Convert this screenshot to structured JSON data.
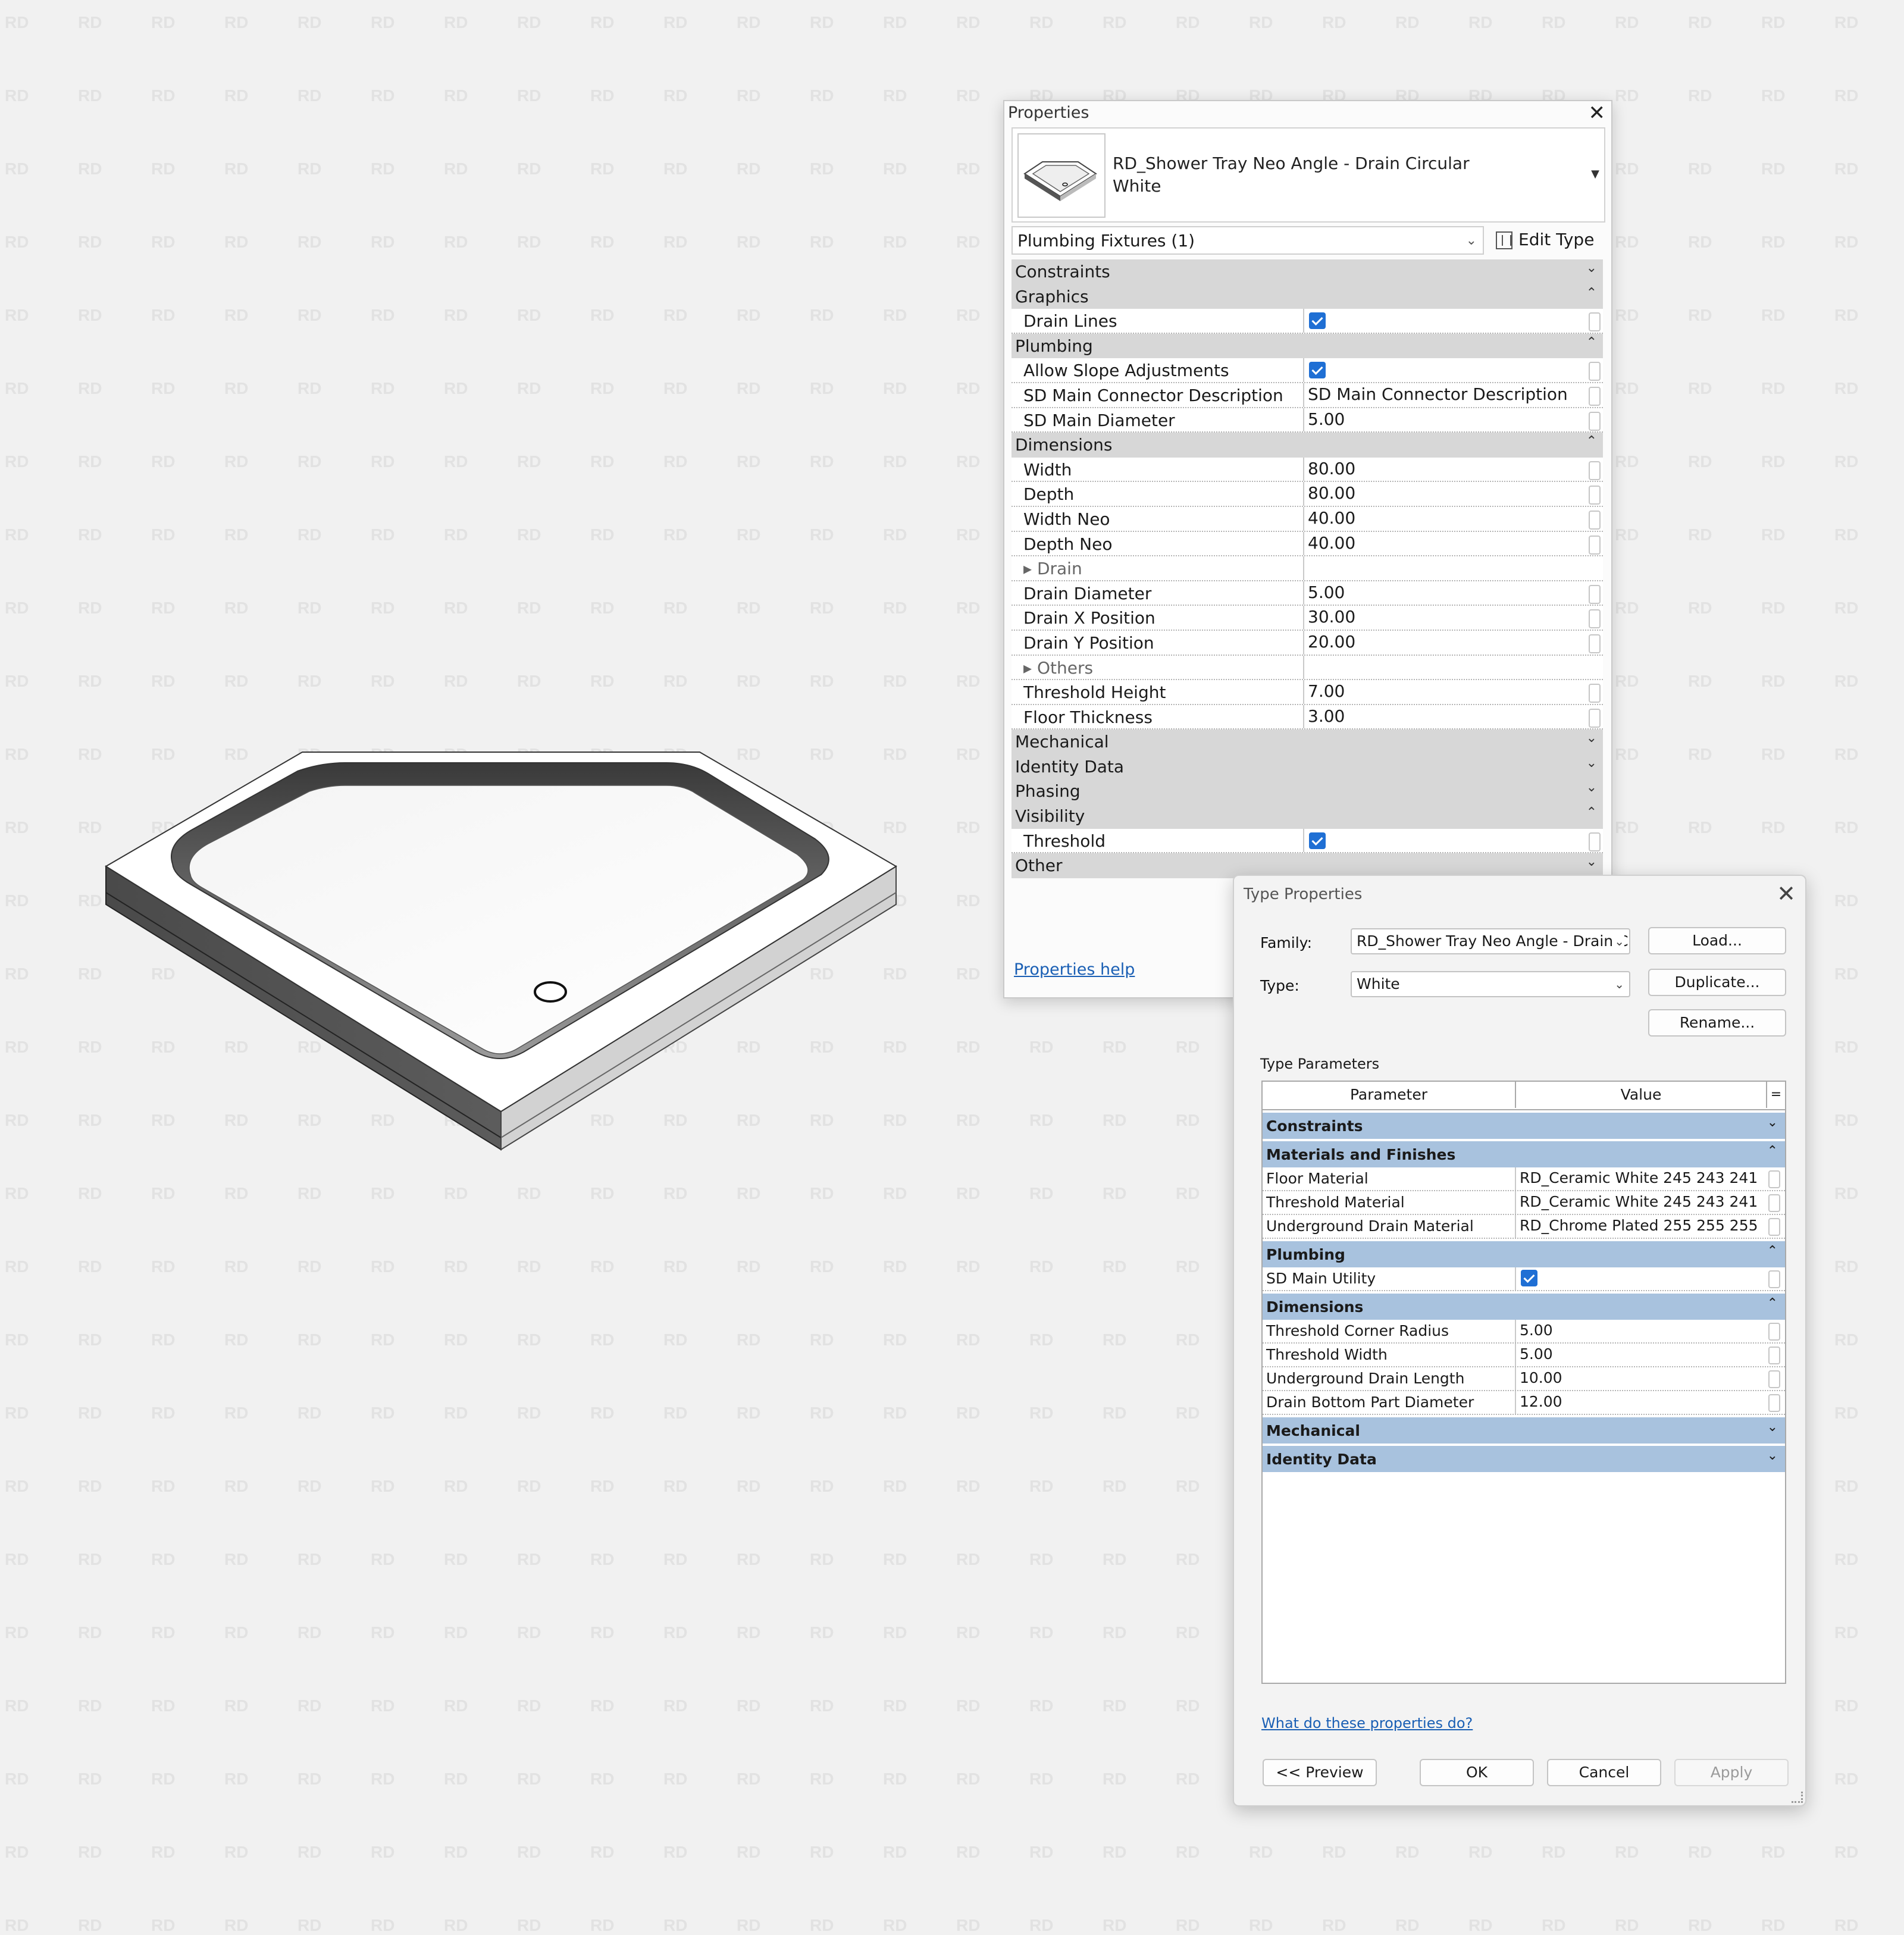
{
  "watermark_text": "RD",
  "properties": {
    "title": "Properties",
    "family_name_line1": "RD_Shower Tray Neo Angle - Drain Circular",
    "family_name_line2": "White",
    "filter": "Plumbing Fixtures (1)",
    "edit_type": "Edit Type",
    "help_link": "Properties help",
    "groups": [
      {
        "label": "Constraints",
        "expanded": false,
        "params": []
      },
      {
        "label": "Graphics",
        "expanded": true,
        "params": [
          {
            "label": "Drain Lines",
            "type": "check",
            "value": ""
          }
        ]
      },
      {
        "label": "Plumbing",
        "expanded": true,
        "params": [
          {
            "label": "Allow Slope Adjustments",
            "type": "check",
            "value": ""
          },
          {
            "label": "SD Main Connector Description",
            "type": "text",
            "value": "SD Main Connector Description"
          },
          {
            "label": "SD Main Diameter",
            "type": "text",
            "value": "5.00"
          }
        ]
      },
      {
        "label": "Dimensions",
        "expanded": true,
        "params": [
          {
            "label": "Width",
            "type": "text",
            "value": "80.00"
          },
          {
            "label": "Depth",
            "type": "text",
            "value": "80.00"
          },
          {
            "label": "Width Neo",
            "type": "text",
            "value": "40.00"
          },
          {
            "label": "Depth Neo",
            "type": "text",
            "value": "40.00"
          },
          {
            "label": "▸ Drain",
            "type": "sub",
            "value": ""
          },
          {
            "label": "Drain Diameter",
            "type": "text",
            "value": "5.00"
          },
          {
            "label": "Drain X Position",
            "type": "text",
            "value": "30.00"
          },
          {
            "label": "Drain Y Position",
            "type": "text",
            "value": "20.00"
          },
          {
            "label": "▸ Others",
            "type": "sub",
            "value": ""
          },
          {
            "label": "Threshold Height",
            "type": "text",
            "value": "7.00"
          },
          {
            "label": "Floor Thickness",
            "type": "text",
            "value": "3.00"
          }
        ]
      },
      {
        "label": "Mechanical",
        "expanded": false,
        "params": []
      },
      {
        "label": "Identity Data",
        "expanded": false,
        "params": []
      },
      {
        "label": "Phasing",
        "expanded": false,
        "params": []
      },
      {
        "label": "Visibility",
        "expanded": true,
        "params": [
          {
            "label": "Threshold",
            "type": "check",
            "value": ""
          }
        ]
      },
      {
        "label": "Other",
        "expanded": false,
        "params": []
      }
    ]
  },
  "type_properties": {
    "title": "Type Properties",
    "family_label": "Family:",
    "family_value": "RD_Shower Tray Neo Angle - Drain Circ",
    "type_label": "Type:",
    "type_value": "White",
    "load": "Load...",
    "duplicate": "Duplicate...",
    "rename": "Rename...",
    "section": "Type Parameters",
    "col_param": "Parameter",
    "col_value": "Value",
    "col_eq": "=",
    "groups": [
      {
        "label": "Constraints",
        "expanded": false,
        "params": []
      },
      {
        "label": "Materials and Finishes",
        "expanded": true,
        "params": [
          {
            "label": "Floor Material",
            "type": "text",
            "value": "RD_Ceramic White 245 243 241"
          },
          {
            "label": "Threshold Material",
            "type": "text",
            "value": "RD_Ceramic White 245 243 241"
          },
          {
            "label": "Underground Drain Material",
            "type": "text",
            "value": "RD_Chrome Plated 255 255 255"
          }
        ]
      },
      {
        "label": "Plumbing",
        "expanded": true,
        "params": [
          {
            "label": "SD Main Utility",
            "type": "check",
            "value": ""
          }
        ]
      },
      {
        "label": "Dimensions",
        "expanded": true,
        "params": [
          {
            "label": "Threshold Corner Radius",
            "type": "text",
            "value": "5.00"
          },
          {
            "label": "Threshold Width",
            "type": "text",
            "value": "5.00"
          },
          {
            "label": "Underground Drain Length",
            "type": "text",
            "value": "10.00"
          },
          {
            "label": "Drain Bottom Part Diameter",
            "type": "text",
            "value": "12.00"
          }
        ]
      },
      {
        "label": "Mechanical",
        "expanded": false,
        "params": []
      },
      {
        "label": "Identity Data",
        "expanded": false,
        "params": []
      }
    ],
    "help_link": "What do these properties do?",
    "preview": "<< Preview",
    "ok": "OK",
    "cancel": "Cancel",
    "apply": "Apply"
  },
  "icons": {
    "expanded": "⌃",
    "collapsed": "⌄",
    "close": "✕",
    "dropdown": "⌄"
  },
  "colors": {
    "checkbox": "#1f6fd4",
    "type_group_header": "#a8c2de",
    "properties_group_header": "#d7d7d7",
    "link": "#1a5fb4"
  }
}
